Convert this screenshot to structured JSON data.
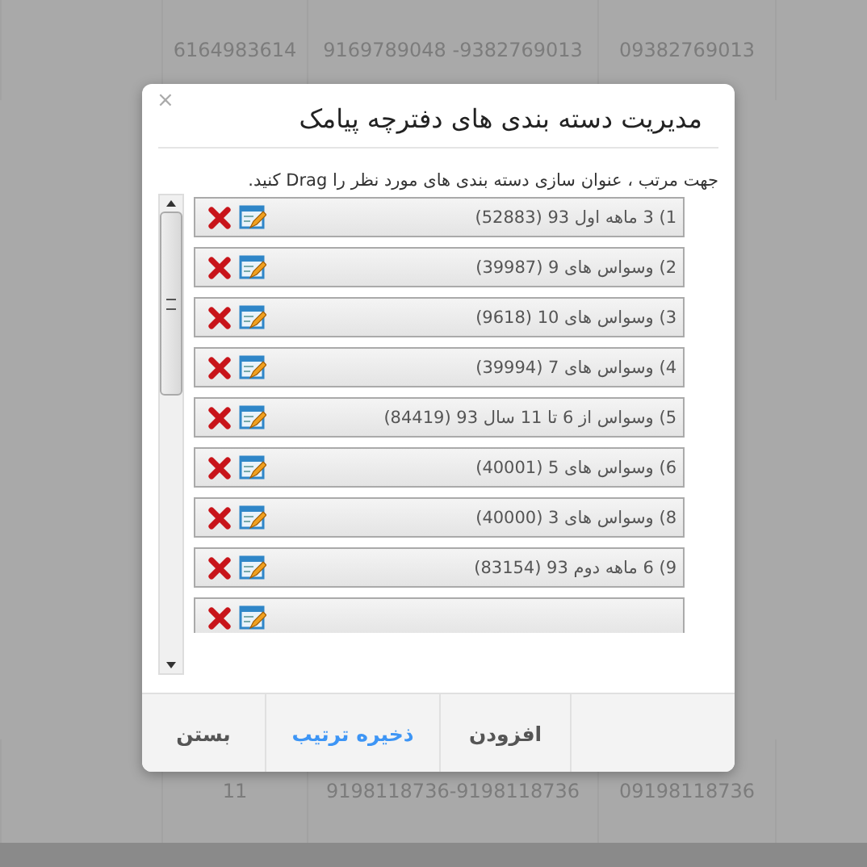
{
  "background_table": {
    "rows": [
      {
        "cells": [
          "09382769013",
          "9169789048 -9382769013",
          "6164983614"
        ]
      },
      {
        "cells": [
          "09198118736",
          "9198118736-9198118736",
          "11"
        ]
      }
    ]
  },
  "dialog": {
    "close": "×",
    "title": "مدیریت دسته بندی های دفترچه پیامک",
    "instruction": "جهت مرتب ، عنوان سازی دسته بندی های مورد نظر را Drag کنید.",
    "items": [
      {
        "kind": "row",
        "label": "1) 3 ماهه اول 93 (52883)"
      },
      {
        "kind": "row",
        "label": "2) وسواس های 9 (39987)"
      },
      {
        "kind": "row",
        "label": "3) وسواس های 10 (9618)"
      },
      {
        "kind": "row",
        "label": "4) وسواس های 7 (39994)"
      },
      {
        "kind": "row",
        "label": "5) وسواس از 6 تا 11 سال 93 (84419)"
      },
      {
        "kind": "row",
        "label": "6) وسواس های 5 (40001)"
      },
      {
        "kind": "row",
        "label": "8) وسواس های 3 (40000)"
      },
      {
        "kind": "row",
        "label": "9) 6 ماهه دوم 93 (83154)"
      },
      {
        "kind": "cut_off"
      }
    ],
    "buttons": [
      {
        "label": "افزودن",
        "kind": "plain"
      },
      {
        "label": "ذخیره ترتیب",
        "kind": "primary"
      },
      {
        "label": "بستن",
        "kind": "plain"
      }
    ]
  }
}
